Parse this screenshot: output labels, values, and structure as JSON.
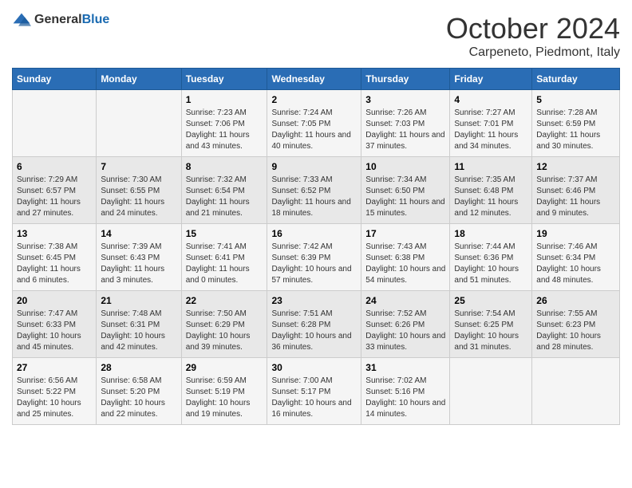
{
  "header": {
    "logo_general": "General",
    "logo_blue": "Blue",
    "month_title": "October 2024",
    "location": "Carpeneto, Piedmont, Italy"
  },
  "weekdays": [
    "Sunday",
    "Monday",
    "Tuesday",
    "Wednesday",
    "Thursday",
    "Friday",
    "Saturday"
  ],
  "weeks": [
    [
      {
        "day": "",
        "sunrise": "",
        "sunset": "",
        "daylight": ""
      },
      {
        "day": "",
        "sunrise": "",
        "sunset": "",
        "daylight": ""
      },
      {
        "day": "1",
        "sunrise": "Sunrise: 7:23 AM",
        "sunset": "Sunset: 7:06 PM",
        "daylight": "Daylight: 11 hours and 43 minutes."
      },
      {
        "day": "2",
        "sunrise": "Sunrise: 7:24 AM",
        "sunset": "Sunset: 7:05 PM",
        "daylight": "Daylight: 11 hours and 40 minutes."
      },
      {
        "day": "3",
        "sunrise": "Sunrise: 7:26 AM",
        "sunset": "Sunset: 7:03 PM",
        "daylight": "Daylight: 11 hours and 37 minutes."
      },
      {
        "day": "4",
        "sunrise": "Sunrise: 7:27 AM",
        "sunset": "Sunset: 7:01 PM",
        "daylight": "Daylight: 11 hours and 34 minutes."
      },
      {
        "day": "5",
        "sunrise": "Sunrise: 7:28 AM",
        "sunset": "Sunset: 6:59 PM",
        "daylight": "Daylight: 11 hours and 30 minutes."
      }
    ],
    [
      {
        "day": "6",
        "sunrise": "Sunrise: 7:29 AM",
        "sunset": "Sunset: 6:57 PM",
        "daylight": "Daylight: 11 hours and 27 minutes."
      },
      {
        "day": "7",
        "sunrise": "Sunrise: 7:30 AM",
        "sunset": "Sunset: 6:55 PM",
        "daylight": "Daylight: 11 hours and 24 minutes."
      },
      {
        "day": "8",
        "sunrise": "Sunrise: 7:32 AM",
        "sunset": "Sunset: 6:54 PM",
        "daylight": "Daylight: 11 hours and 21 minutes."
      },
      {
        "day": "9",
        "sunrise": "Sunrise: 7:33 AM",
        "sunset": "Sunset: 6:52 PM",
        "daylight": "Daylight: 11 hours and 18 minutes."
      },
      {
        "day": "10",
        "sunrise": "Sunrise: 7:34 AM",
        "sunset": "Sunset: 6:50 PM",
        "daylight": "Daylight: 11 hours and 15 minutes."
      },
      {
        "day": "11",
        "sunrise": "Sunrise: 7:35 AM",
        "sunset": "Sunset: 6:48 PM",
        "daylight": "Daylight: 11 hours and 12 minutes."
      },
      {
        "day": "12",
        "sunrise": "Sunrise: 7:37 AM",
        "sunset": "Sunset: 6:46 PM",
        "daylight": "Daylight: 11 hours and 9 minutes."
      }
    ],
    [
      {
        "day": "13",
        "sunrise": "Sunrise: 7:38 AM",
        "sunset": "Sunset: 6:45 PM",
        "daylight": "Daylight: 11 hours and 6 minutes."
      },
      {
        "day": "14",
        "sunrise": "Sunrise: 7:39 AM",
        "sunset": "Sunset: 6:43 PM",
        "daylight": "Daylight: 11 hours and 3 minutes."
      },
      {
        "day": "15",
        "sunrise": "Sunrise: 7:41 AM",
        "sunset": "Sunset: 6:41 PM",
        "daylight": "Daylight: 11 hours and 0 minutes."
      },
      {
        "day": "16",
        "sunrise": "Sunrise: 7:42 AM",
        "sunset": "Sunset: 6:39 PM",
        "daylight": "Daylight: 10 hours and 57 minutes."
      },
      {
        "day": "17",
        "sunrise": "Sunrise: 7:43 AM",
        "sunset": "Sunset: 6:38 PM",
        "daylight": "Daylight: 10 hours and 54 minutes."
      },
      {
        "day": "18",
        "sunrise": "Sunrise: 7:44 AM",
        "sunset": "Sunset: 6:36 PM",
        "daylight": "Daylight: 10 hours and 51 minutes."
      },
      {
        "day": "19",
        "sunrise": "Sunrise: 7:46 AM",
        "sunset": "Sunset: 6:34 PM",
        "daylight": "Daylight: 10 hours and 48 minutes."
      }
    ],
    [
      {
        "day": "20",
        "sunrise": "Sunrise: 7:47 AM",
        "sunset": "Sunset: 6:33 PM",
        "daylight": "Daylight: 10 hours and 45 minutes."
      },
      {
        "day": "21",
        "sunrise": "Sunrise: 7:48 AM",
        "sunset": "Sunset: 6:31 PM",
        "daylight": "Daylight: 10 hours and 42 minutes."
      },
      {
        "day": "22",
        "sunrise": "Sunrise: 7:50 AM",
        "sunset": "Sunset: 6:29 PM",
        "daylight": "Daylight: 10 hours and 39 minutes."
      },
      {
        "day": "23",
        "sunrise": "Sunrise: 7:51 AM",
        "sunset": "Sunset: 6:28 PM",
        "daylight": "Daylight: 10 hours and 36 minutes."
      },
      {
        "day": "24",
        "sunrise": "Sunrise: 7:52 AM",
        "sunset": "Sunset: 6:26 PM",
        "daylight": "Daylight: 10 hours and 33 minutes."
      },
      {
        "day": "25",
        "sunrise": "Sunrise: 7:54 AM",
        "sunset": "Sunset: 6:25 PM",
        "daylight": "Daylight: 10 hours and 31 minutes."
      },
      {
        "day": "26",
        "sunrise": "Sunrise: 7:55 AM",
        "sunset": "Sunset: 6:23 PM",
        "daylight": "Daylight: 10 hours and 28 minutes."
      }
    ],
    [
      {
        "day": "27",
        "sunrise": "Sunrise: 6:56 AM",
        "sunset": "Sunset: 5:22 PM",
        "daylight": "Daylight: 10 hours and 25 minutes."
      },
      {
        "day": "28",
        "sunrise": "Sunrise: 6:58 AM",
        "sunset": "Sunset: 5:20 PM",
        "daylight": "Daylight: 10 hours and 22 minutes."
      },
      {
        "day": "29",
        "sunrise": "Sunrise: 6:59 AM",
        "sunset": "Sunset: 5:19 PM",
        "daylight": "Daylight: 10 hours and 19 minutes."
      },
      {
        "day": "30",
        "sunrise": "Sunrise: 7:00 AM",
        "sunset": "Sunset: 5:17 PM",
        "daylight": "Daylight: 10 hours and 16 minutes."
      },
      {
        "day": "31",
        "sunrise": "Sunrise: 7:02 AM",
        "sunset": "Sunset: 5:16 PM",
        "daylight": "Daylight: 10 hours and 14 minutes."
      },
      {
        "day": "",
        "sunrise": "",
        "sunset": "",
        "daylight": ""
      },
      {
        "day": "",
        "sunrise": "",
        "sunset": "",
        "daylight": ""
      }
    ]
  ]
}
